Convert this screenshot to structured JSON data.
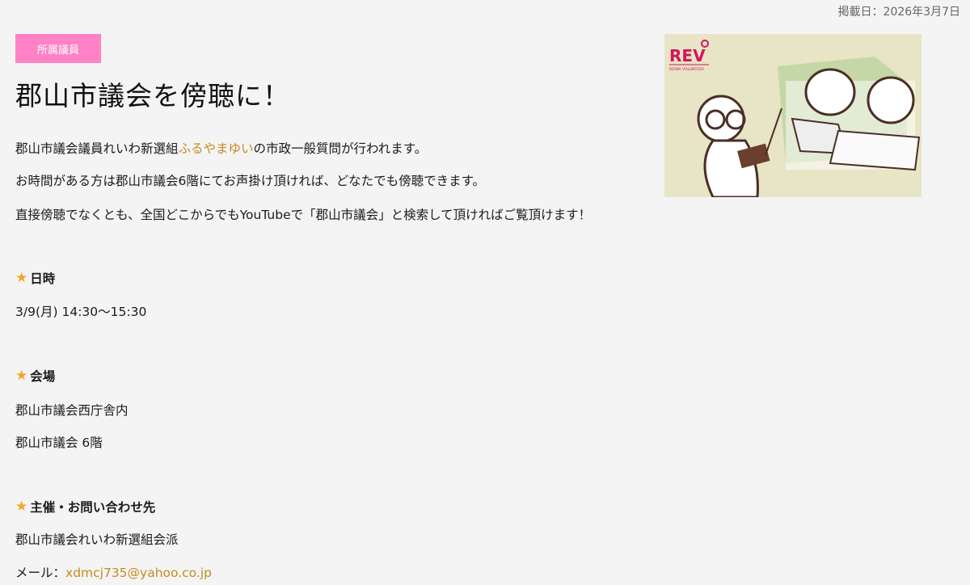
{
  "posted_date": "掲載日：2026年3月7日",
  "category_tag": "所属議員",
  "title": "郡山市議会を傍聴に！",
  "intro": {
    "line1_before": "郡山市議会議員れいわ新選組",
    "line1_link": "ふるやまゆい",
    "line1_after": "の市政一般質問が行われます。",
    "line2": "お時間がある方は郡山市議会6階にてお声掛け頂ければ、どなたでも傍聴できます。",
    "line3": "直接傍聴でなくとも、全国どこからでもYouTubeで「郡山市議会」と検索して頂ければご覧頂けます！"
  },
  "sections": {
    "datetime": {
      "heading": "日時",
      "value": "3/9(月) 14:30〜15:30"
    },
    "venue": {
      "heading": "会場",
      "line1": "郡山市議会西庁舎内",
      "line2": "郡山市議会 6階"
    },
    "contact": {
      "heading": "主催・お問い合わせ先",
      "org": "郡山市議会れいわ新選組会派",
      "email_label": "メール：",
      "email": "xdmcj735@yahoo.co.jp"
    }
  },
  "thumbnail": {
    "logo_text": "REV",
    "logo_sub": "REIWA VOLUNTEER"
  },
  "colors": {
    "tag_bg": "#ff82c6",
    "link": "#c88a22",
    "star": "#f4a623",
    "background": "#f4f4f4"
  }
}
